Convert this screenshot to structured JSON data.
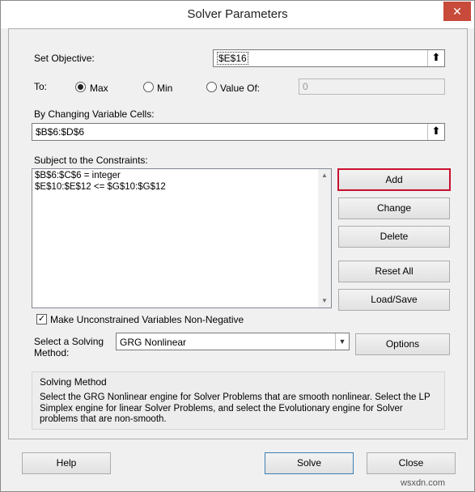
{
  "window": {
    "title": "Solver Parameters",
    "close_glyph": "✕"
  },
  "objective": {
    "label": "Set Objective:",
    "value": "$E$16"
  },
  "to": {
    "label": "To:",
    "max_label": "Max",
    "min_label": "Min",
    "value_of_label": "Value Of:",
    "value_of_value": "0",
    "selected": "Max"
  },
  "variables": {
    "label": "By Changing Variable Cells:",
    "value": "$B$6:$D$6"
  },
  "constraints": {
    "label": "Subject to the Constraints:",
    "items": [
      "$B$6:$C$6 = integer",
      "$E$10:$E$12 <= $G$10:$G$12"
    ]
  },
  "side_buttons": {
    "add": "Add",
    "change": "Change",
    "delete": "Delete",
    "reset_all": "Reset All",
    "load_save": "Load/Save"
  },
  "nonneg": {
    "label": "Make Unconstrained Variables Non-Negative",
    "checked": true
  },
  "solving_method": {
    "label_line1": "Select a Solving",
    "label_line2": "Method:",
    "selected": "GRG Nonlinear",
    "options_button": "Options"
  },
  "method_info": {
    "heading": "Solving Method",
    "text": "Select the GRG Nonlinear engine for Solver Problems that are smooth nonlinear. Select the LP Simplex engine for linear Solver Problems, and select the Evolutionary engine for Solver problems that are non-smooth."
  },
  "footer": {
    "help": "Help",
    "solve": "Solve",
    "close": "Close"
  },
  "watermark": "wsxdn.com",
  "colors": {
    "highlight_border": "#c8102e",
    "close_button": "#c74a3a"
  }
}
